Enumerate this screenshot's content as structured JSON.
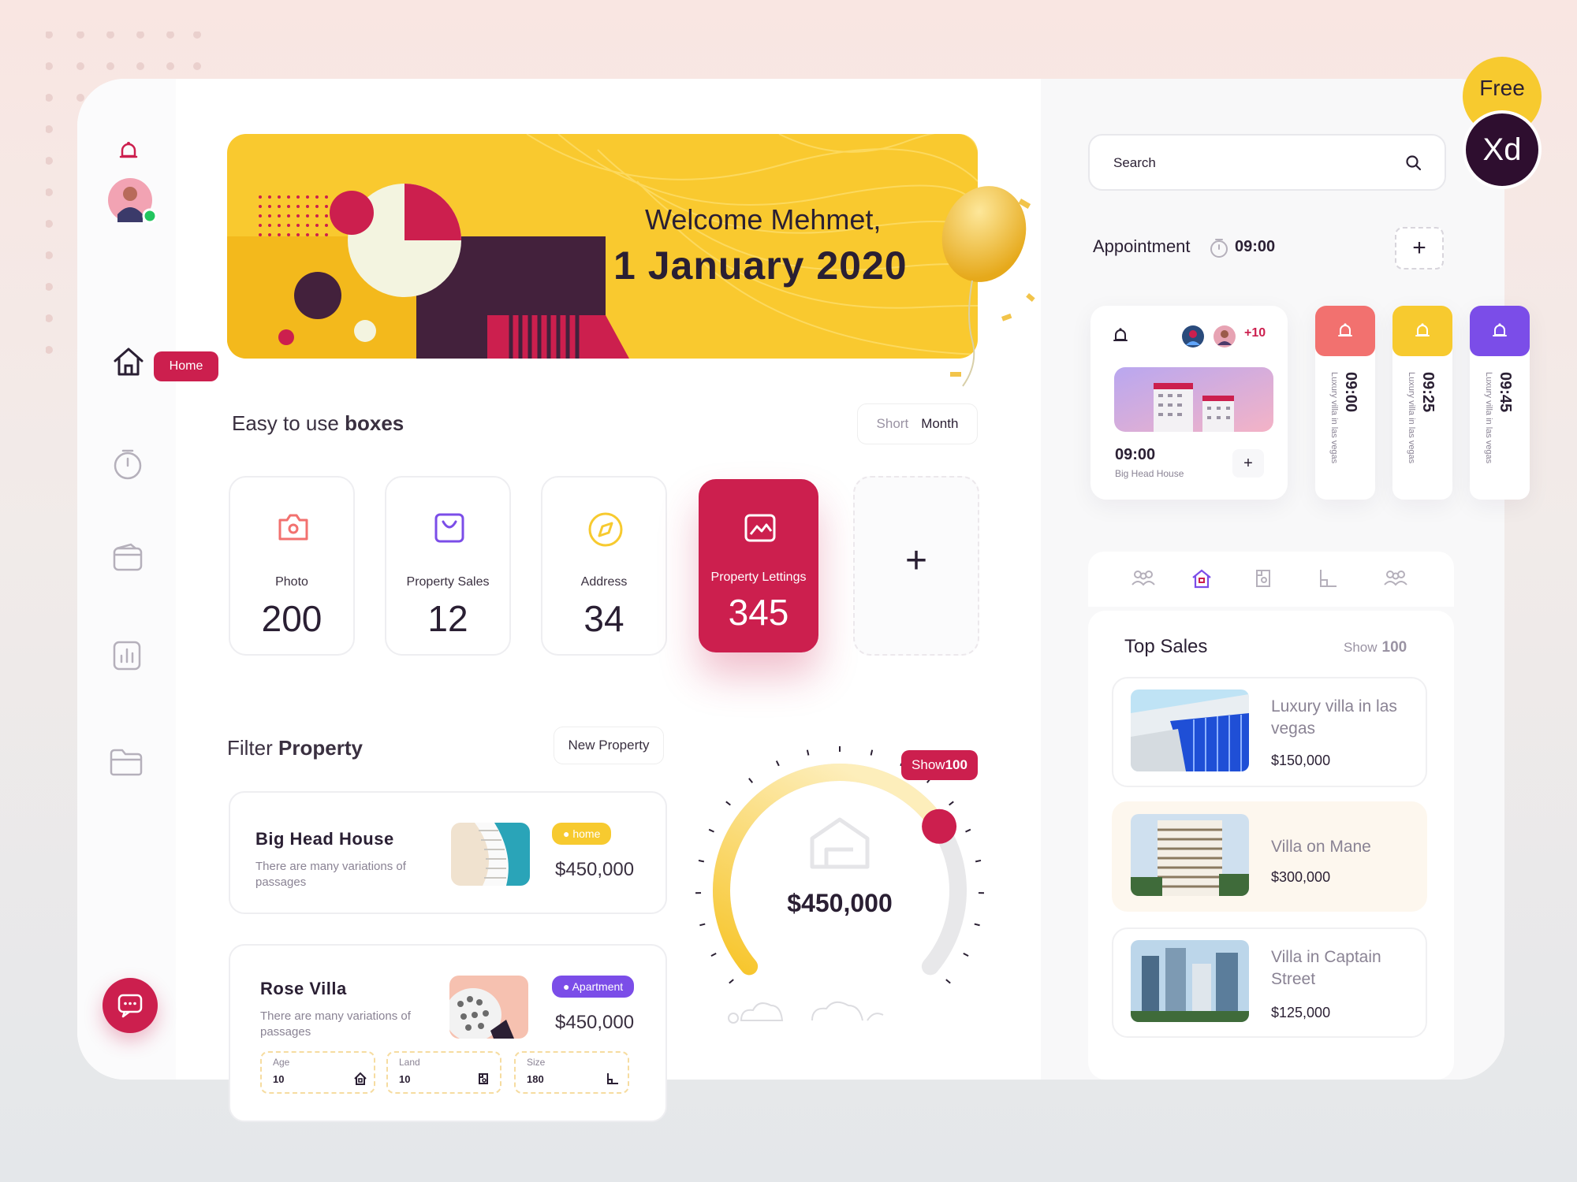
{
  "colors": {
    "accent": "#cc1f4e",
    "yellow": "#f9c92f",
    "purple": "#7b4de8",
    "coral": "#f2716f",
    "dark": "#2a1f33"
  },
  "sidebar": {
    "items": [
      {
        "icon": "bell-icon"
      },
      {
        "icon": "avatar"
      },
      {
        "icon": "home-icon",
        "tooltip": "Home"
      },
      {
        "icon": "timer-icon"
      },
      {
        "icon": "wallet-icon"
      },
      {
        "icon": "chart-icon"
      },
      {
        "icon": "folder-icon"
      }
    ],
    "home_label": "Home",
    "chat_icon": "chat-icon"
  },
  "banner": {
    "greeting": "Welcome Mehmet,",
    "date": "1 January 2020"
  },
  "boxes_section": {
    "title_prefix": "Easy to use",
    "title_bold": "boxes",
    "toggle": {
      "off": "Short",
      "on": "Month"
    },
    "boxes": [
      {
        "label": "Photo",
        "value": "200",
        "icon": "camera-icon"
      },
      {
        "label": "Property Sales",
        "value": "12",
        "icon": "shopping-bag-icon"
      },
      {
        "label": "Address",
        "value": "34",
        "icon": "compass-icon"
      },
      {
        "label": "Property Lettings",
        "value": "345",
        "icon": "image-icon",
        "active": true
      }
    ],
    "add_label": "+"
  },
  "filter": {
    "title_prefix": "Filter",
    "title_bold": "Property",
    "new_button": "New Property",
    "properties": [
      {
        "name": "Big Head House",
        "desc": "There are many variations of passages",
        "badge": "● home",
        "price": "$450,000"
      },
      {
        "name": "Rose Villa",
        "desc": "There are many variations of passages",
        "badge": "● Apartment",
        "price": "$450,000",
        "specs": [
          {
            "k": "Age",
            "v": "10"
          },
          {
            "k": "Land",
            "v": "10"
          },
          {
            "k": "Size",
            "v": "180"
          }
        ]
      }
    ]
  },
  "gauge": {
    "value": "$450,000",
    "show_label": "Show",
    "show_value": "100",
    "fraction": 0.72
  },
  "search": {
    "placeholder": "Search"
  },
  "appointment": {
    "label": "Appointment",
    "time": "09:00",
    "add": "+",
    "card": {
      "more": "+10",
      "time": "09:00",
      "place": "Big Head House",
      "plus": "+"
    },
    "minis": [
      {
        "time": "09:00",
        "desc": "Luxury villa in las vegas",
        "color": "#f2716f"
      },
      {
        "time": "09:25",
        "desc": "Luxury villa in las vegas",
        "color": "#f7ca2f"
      },
      {
        "time": "09:45",
        "desc": "Luxury villa in las vegas",
        "color": "#7b4de8"
      }
    ]
  },
  "top_sales": {
    "title": "Top Sales",
    "show_label": "Show",
    "show_value": "100",
    "tabs": [
      "people-icon",
      "home-icon",
      "land-icon",
      "size-icon",
      "people-icon"
    ],
    "items": [
      {
        "name": "Luxury villa in las vegas",
        "price": "$150,000"
      },
      {
        "name": "Villa on Mane",
        "price": "$300,000"
      },
      {
        "name": "Villa in Captain Street",
        "price": "$125,000"
      }
    ]
  },
  "badge": {
    "free": "Free",
    "xd": "Xd"
  }
}
